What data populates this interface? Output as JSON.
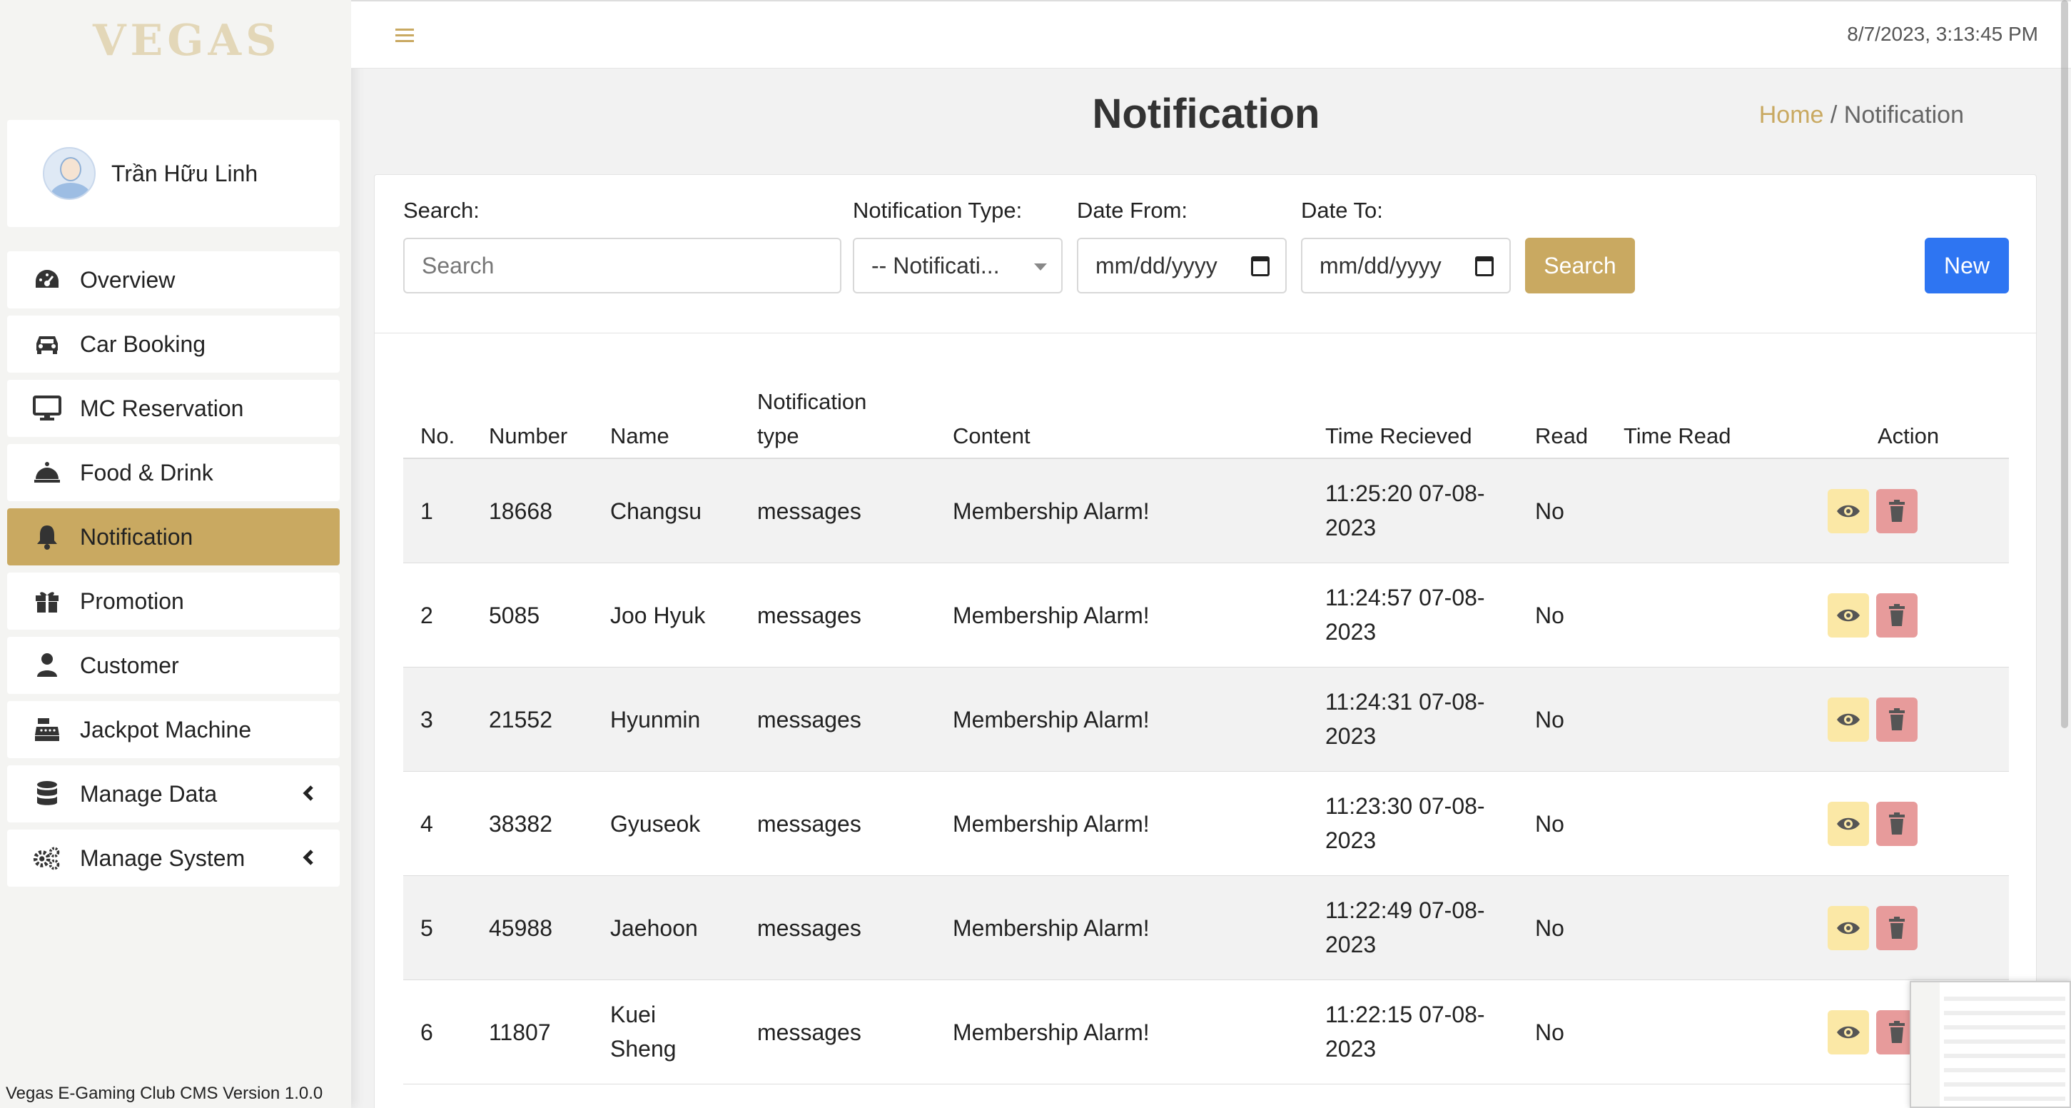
{
  "app": {
    "logo_text": "VEGAS",
    "version": "Vegas E-Gaming Club CMS Version 1.0.0",
    "datetime": "8/7/2023, 3:13:45 PM"
  },
  "user": {
    "name": "Trần Hữu Linh"
  },
  "sidebar": {
    "items": [
      {
        "label": "Overview",
        "icon": "dashboard-icon"
      },
      {
        "label": "Car Booking",
        "icon": "car-icon"
      },
      {
        "label": "MC Reservation",
        "icon": "monitor-icon"
      },
      {
        "label": "Food & Drink",
        "icon": "cloche-icon"
      },
      {
        "label": "Notification",
        "icon": "bell-icon",
        "active": true
      },
      {
        "label": "Promotion",
        "icon": "gift-icon"
      },
      {
        "label": "Customer",
        "icon": "user-icon"
      },
      {
        "label": "Jackpot Machine",
        "icon": "cash-register-icon"
      },
      {
        "label": "Manage Data",
        "icon": "database-icon",
        "expandable": true
      },
      {
        "label": "Manage System",
        "icon": "gears-icon",
        "expandable": true
      }
    ]
  },
  "page": {
    "title": "Notification",
    "breadcrumb": {
      "home": "Home",
      "separator": " / ",
      "current": "Notification"
    }
  },
  "filters": {
    "search_label": "Search:",
    "search_placeholder": "Search",
    "type_label": "Notification Type:",
    "type_value": "-- Notificati...",
    "date_from_label": "Date From:",
    "date_from_placeholder": "mm/dd/yyyy",
    "date_to_label": "Date To:",
    "date_to_placeholder": "mm/dd/yyyy",
    "search_button": "Search",
    "new_button": "New"
  },
  "table": {
    "headers": {
      "no": "No.",
      "number": "Number",
      "name": "Name",
      "type_line1": "Notification",
      "type_line2": "type",
      "content": "Content",
      "time_received": "Time Recieved",
      "read": "Read",
      "time_read": "Time Read",
      "action": "Action"
    },
    "rows": [
      {
        "no": "1",
        "number": "18668",
        "name1": "Changsu",
        "name2": "",
        "type": "messages",
        "content": "Membership Alarm!",
        "time1": "11:25:20 07-08-",
        "time2": "2023",
        "read": "No",
        "time_read": ""
      },
      {
        "no": "2",
        "number": "5085",
        "name1": "Joo Hyuk",
        "name2": "",
        "type": "messages",
        "content": "Membership Alarm!",
        "time1": "11:24:57 07-08-",
        "time2": "2023",
        "read": "No",
        "time_read": ""
      },
      {
        "no": "3",
        "number": "21552",
        "name1": "Hyunmin",
        "name2": "",
        "type": "messages",
        "content": "Membership Alarm!",
        "time1": "11:24:31 07-08-",
        "time2": "2023",
        "read": "No",
        "time_read": ""
      },
      {
        "no": "4",
        "number": "38382",
        "name1": "Gyuseok",
        "name2": "",
        "type": "messages",
        "content": "Membership Alarm!",
        "time1": "11:23:30 07-08-",
        "time2": "2023",
        "read": "No",
        "time_read": ""
      },
      {
        "no": "5",
        "number": "45988",
        "name1": "Jaehoon",
        "name2": "",
        "type": "messages",
        "content": "Membership Alarm!",
        "time1": "11:22:49 07-08-",
        "time2": "2023",
        "read": "No",
        "time_read": ""
      },
      {
        "no": "6",
        "number": "11807",
        "name1": "Kuei",
        "name2": "Sheng",
        "type": "messages",
        "content": "Membership Alarm!",
        "time1": "11:22:15 07-08-",
        "time2": "2023",
        "read": "No",
        "time_read": ""
      }
    ]
  },
  "colors": {
    "accent": "#c9a961",
    "primary": "#2e75f2",
    "view_button": "#fbe8a6",
    "delete_button": "#e79b9b"
  }
}
